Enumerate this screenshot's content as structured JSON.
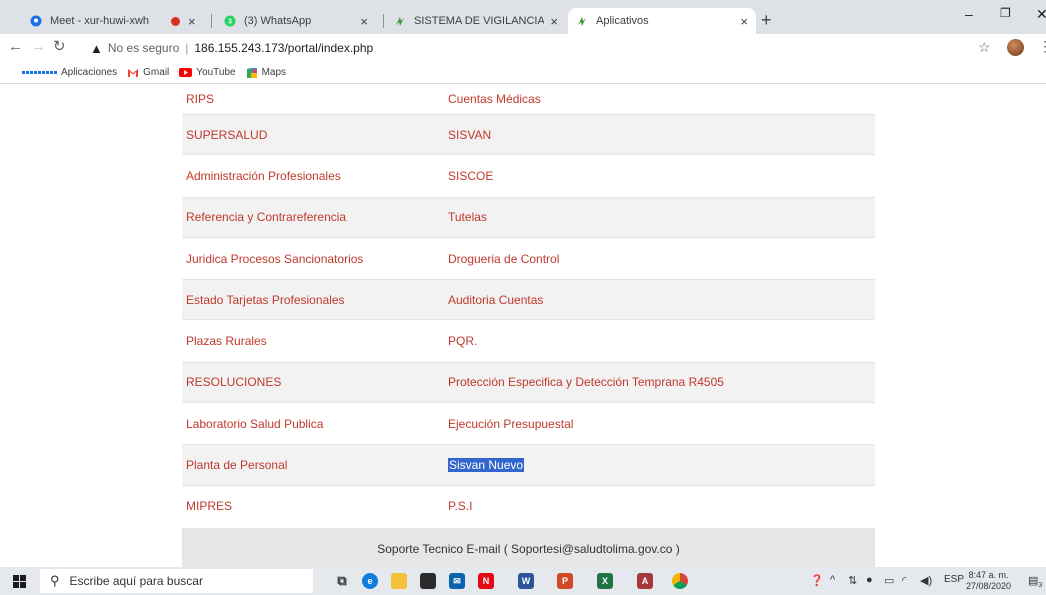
{
  "tabs": [
    {
      "title": "Meet - xur-huwi-xwh",
      "recording": false
    },
    {
      "title": "",
      "recording": true
    },
    {
      "title": "(3) WhatsApp"
    },
    {
      "title": "SISTEMA DE VIGILANCIA EPIDEM"
    },
    {
      "title": "Aplicativos",
      "active": true
    }
  ],
  "tab_close": "×",
  "new_tab": "+",
  "window": {
    "minimize": "–",
    "restore": "❐",
    "close": "✕"
  },
  "address": {
    "security_label": "No es seguro",
    "separator": "|",
    "url": "186.155.243.173/portal/index.php"
  },
  "bookmarks": [
    {
      "label": "Aplicaciones",
      "icon": "apps-grid-icon"
    },
    {
      "label": "Gmail",
      "icon": "gmail-icon"
    },
    {
      "label": "YouTube",
      "icon": "youtube-icon"
    },
    {
      "label": "Maps",
      "icon": "maps-icon"
    }
  ],
  "links": [
    {
      "left": "RIPS",
      "right": "Cuentas Médicas"
    },
    {
      "left": "SUPERSALUD",
      "right": "SISVAN"
    },
    {
      "left": "Administración Profesionales",
      "right": "SISCOE"
    },
    {
      "left": "Referencia y Contrareferencia",
      "right": "Tutelas"
    },
    {
      "left": "Juridica Procesos Sancionatorios",
      "right": "Drogueria de Control"
    },
    {
      "left": "Estado Tarjetas Profesionales",
      "right": "Auditoria Cuentas"
    },
    {
      "left": "Plazas Rurales",
      "right": "PQR."
    },
    {
      "left": "RESOLUCIONES",
      "right": "Protección Especifica y Detección Temprana R4505"
    },
    {
      "left": "Laboratorio Salud Publica",
      "right": "Ejecución Presupuestal"
    },
    {
      "left": "Planta de Personal",
      "right": "Sisvan Nuevo",
      "right_selected": true
    },
    {
      "left": "MIPRES",
      "right": "P.S.I"
    }
  ],
  "footer": "Soporte Tecnico E-mail ( Soportesi@saludtolima.gov.co )",
  "colors": {
    "link": "#c0392b",
    "selection": "#3366cc",
    "row_alt": "#f2f2f2",
    "footer_bg": "#e6e6e6"
  },
  "taskbar": {
    "search_placeholder": "Escribe aquí para buscar",
    "lang": "ESP",
    "time": "8:47 a. m.",
    "date": "27/08/2020",
    "notification_count": "3"
  }
}
